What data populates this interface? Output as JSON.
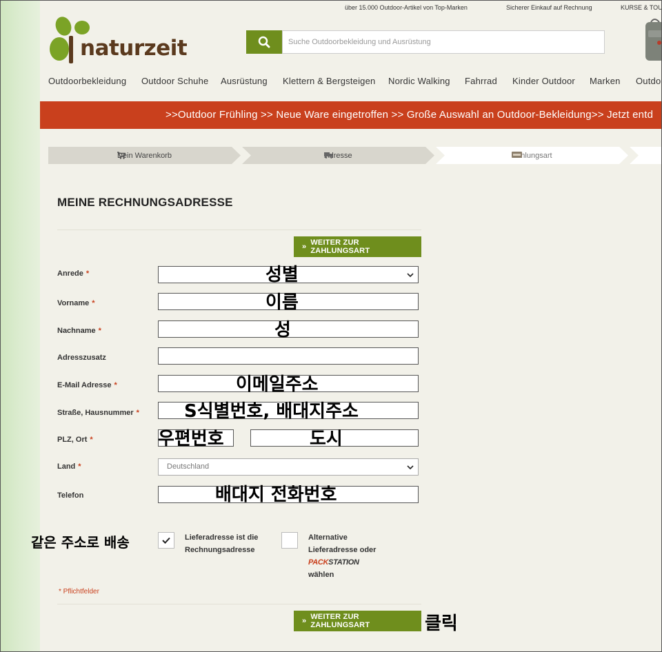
{
  "topbar": {
    "claim1": "über 15.000 Outdoor-Artikel von Top-Marken",
    "claim2": "Sicherer Einkauf auf Rechnung",
    "claim3": "KURSE & TOUR"
  },
  "logo": {
    "text": "naturzeit"
  },
  "search": {
    "placeholder": "Suche Outdoorbekleidung und Ausrüstung"
  },
  "nav": {
    "items": [
      "Outdoorbekleidung",
      "Outdoor Schuhe",
      "Ausrüstung",
      "Klettern & Bergsteigen",
      "Nordic Walking",
      "Fahrrad",
      "Kinder Outdoor",
      "Marken",
      "Outdo"
    ]
  },
  "banner": {
    "text": ">>Outdoor Frühling >> Neue Ware eingetroffen >> Große Auswahl an Outdoor-Bekleidung>> Jetzt entd"
  },
  "steps": [
    {
      "label": "Dein Warenkorb",
      "icon": "cart-icon"
    },
    {
      "label": "Adresse",
      "icon": "truck-icon"
    },
    {
      "label": "Zahlungsart",
      "icon": "payment-icon"
    }
  ],
  "form": {
    "heading": "MEINE RECHNUNGSADRESSE",
    "submit_label": "WEITER ZUR ZAHLUNGSART",
    "fields": {
      "anrede": {
        "label": "Anrede",
        "value": ""
      },
      "vorname": {
        "label": "Vorname",
        "value": ""
      },
      "nachname": {
        "label": "Nachname",
        "value": ""
      },
      "adresszusatz": {
        "label": "Adresszusatz",
        "value": ""
      },
      "email": {
        "label": "E-Mail Adresse",
        "value": ""
      },
      "strasse": {
        "label": "Straße, Hausnummer",
        "value": ""
      },
      "plz_ort": {
        "label": "PLZ, Ort",
        "plz": "",
        "ort": ""
      },
      "land": {
        "label": "Land",
        "value": "Deutschland"
      },
      "telefon": {
        "label": "Telefon",
        "value": ""
      }
    },
    "required_mark": "*",
    "same_address_label_1": "Lieferadresse ist die",
    "same_address_label_2": "Rechnungsadresse",
    "alt_address_label_1": "Alternative",
    "alt_address_label_2": "Lieferadresse oder",
    "packstation_pack": "PACK",
    "packstation_station": "STATION",
    "alt_address_label_3": "wählen",
    "required_note": "* Pflichtfelder"
  },
  "annotations": {
    "anrede": "성별",
    "vorname": "이름",
    "nachname": "성",
    "email": "이메일주소",
    "strasse": "S식별번호, 배대지주소",
    "plz": "우편번호",
    "ort": "도시",
    "telefon": "배대지 전화번호",
    "same_address": "같은 주소로 배송",
    "click": "클릭"
  },
  "colors": {
    "accent_green": "#6f8e1d",
    "banner_red": "#c9401d",
    "background": "#f2f1e9"
  }
}
